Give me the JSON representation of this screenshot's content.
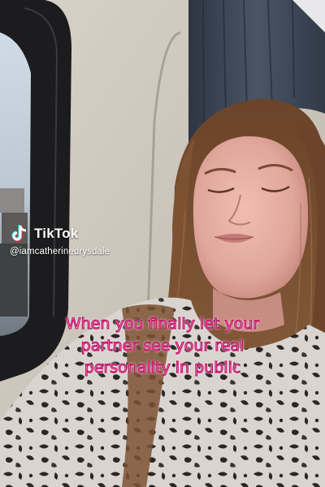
{
  "watermark": {
    "brand": "TikTok",
    "handle": "@iamcatherinedrysdale",
    "logo_icon": "tiktok-logo-icon"
  },
  "caption": {
    "lines": [
      "When you finally let your",
      "partner see your real",
      "personality in public"
    ],
    "fill_color": "#f7a9d3",
    "outline_color": "#c2186a"
  },
  "scene": {
    "description_icon": "photo-scene",
    "colors": {
      "wall": "#cfc9c0",
      "window_frame": "#1c1c1e",
      "curtain": "#3d4655",
      "hair": "#7d5232",
      "skin": "#e3ada3",
      "leopard_base": "#d9d4cf"
    }
  }
}
